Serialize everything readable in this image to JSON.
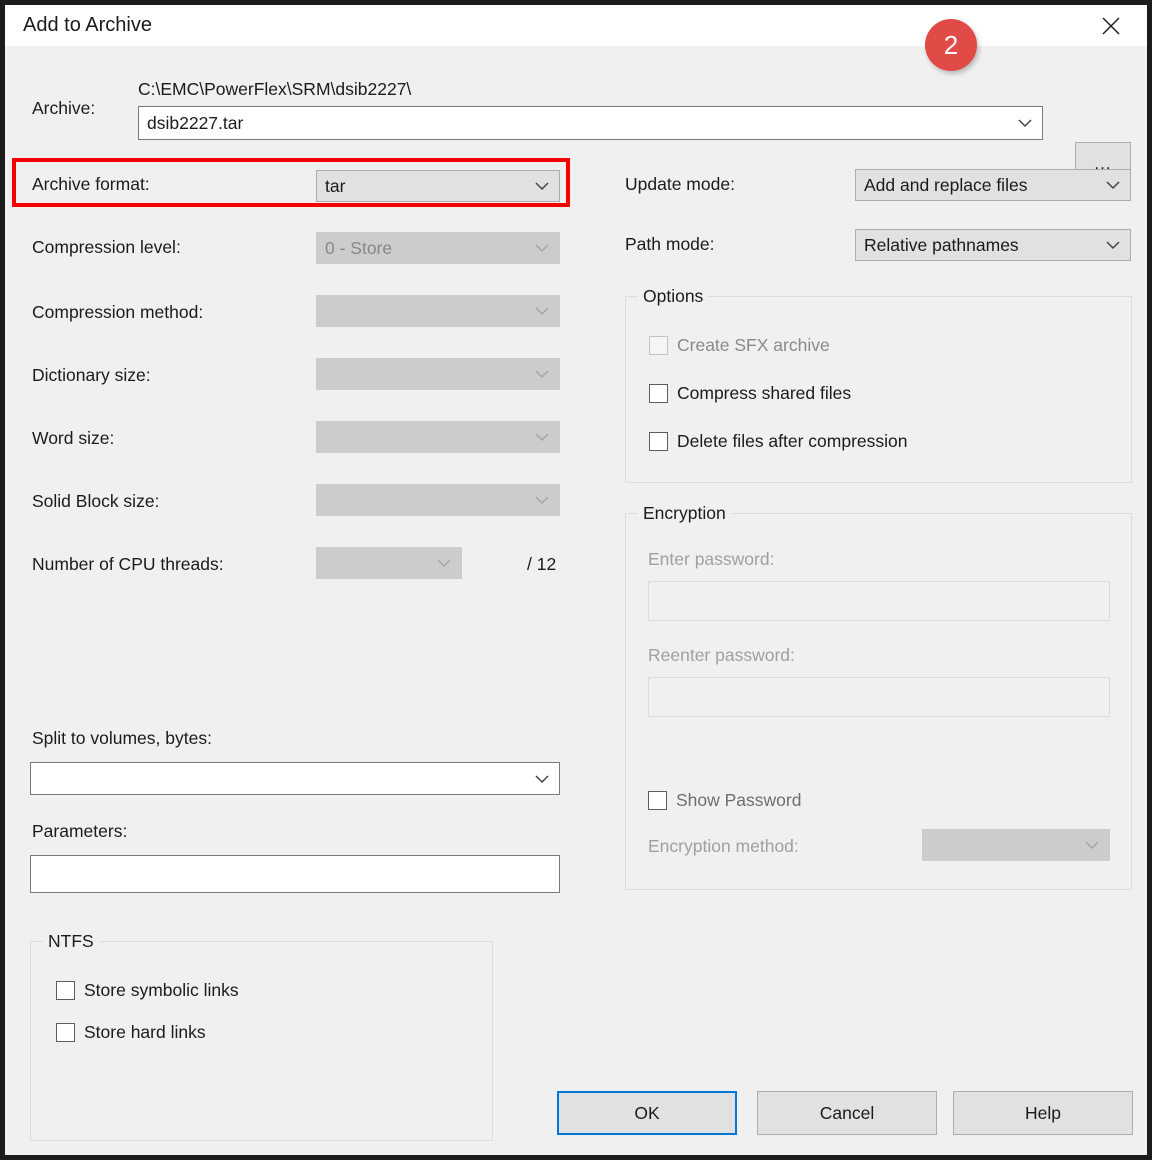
{
  "window": {
    "title": "Add to Archive",
    "close_icon": "close-icon"
  },
  "badge": {
    "label": "2",
    "color": "#e04a47"
  },
  "archive": {
    "label": "Archive:",
    "path": "C:\\EMC\\PowerFlex\\SRM\\dsib2227\\",
    "filename": "dsib2227.tar",
    "browse_label": "..."
  },
  "left": {
    "archive_format": {
      "label": "Archive format:",
      "value": "tar",
      "enabled": true
    },
    "compression_level": {
      "label": "Compression level:",
      "value": "0 - Store",
      "enabled": false
    },
    "compression_method": {
      "label": "Compression method:",
      "value": "",
      "enabled": false
    },
    "dictionary_size": {
      "label": "Dictionary size:",
      "value": "",
      "enabled": false
    },
    "word_size": {
      "label": "Word size:",
      "value": "",
      "enabled": false
    },
    "solid_block_size": {
      "label": "Solid Block size:",
      "value": "",
      "enabled": false
    },
    "cpu_threads": {
      "label": "Number of CPU threads:",
      "value": "",
      "suffix": "/ 12",
      "enabled": false
    },
    "split_volumes": {
      "label": "Split to volumes, bytes:",
      "value": ""
    },
    "parameters": {
      "label": "Parameters:",
      "value": ""
    }
  },
  "ntfs": {
    "title": "NTFS",
    "checkboxes": [
      {
        "label": "Store symbolic links",
        "checked": false,
        "enabled": true
      },
      {
        "label": "Store hard links",
        "checked": false,
        "enabled": true
      }
    ]
  },
  "right": {
    "update_mode": {
      "label": "Update mode:",
      "value": "Add and replace files"
    },
    "path_mode": {
      "label": "Path mode:",
      "value": "Relative pathnames"
    }
  },
  "options": {
    "title": "Options",
    "checkboxes": [
      {
        "label": "Create SFX archive",
        "checked": false,
        "enabled": false
      },
      {
        "label": "Compress shared files",
        "checked": false,
        "enabled": true
      },
      {
        "label": "Delete files after compression",
        "checked": false,
        "enabled": true
      }
    ]
  },
  "encryption": {
    "title": "Encryption",
    "enter_password": {
      "label": "Enter password:",
      "value": ""
    },
    "reenter_password": {
      "label": "Reenter password:",
      "value": ""
    },
    "show_password": {
      "label": "Show Password",
      "checked": false
    },
    "method": {
      "label": "Encryption method:",
      "value": ""
    }
  },
  "buttons": {
    "ok": "OK",
    "cancel": "Cancel",
    "help": "Help",
    "focus_color": "#0078d7"
  }
}
